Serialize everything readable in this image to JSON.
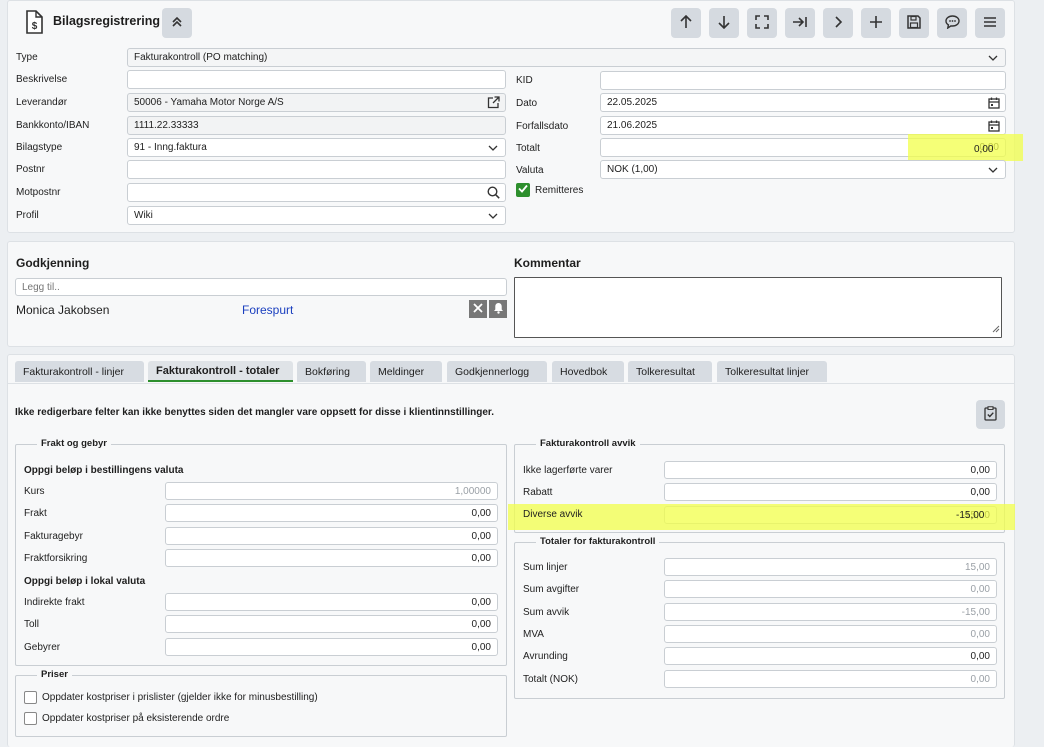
{
  "header": {
    "title": "Bilagsregistrering",
    "toolbar_icons": [
      "arrow-up-icon",
      "arrow-down-icon",
      "fullscreen-icon",
      "goto-last-icon",
      "next-icon",
      "add-icon",
      "save-icon",
      "chat-icon",
      "menu-icon"
    ]
  },
  "form": {
    "type_label": "Type",
    "type_value": "Fakturakontroll (PO matching)",
    "beskrivelse_label": "Beskrivelse",
    "beskrivelse_value": "",
    "leverandor_label": "Leverandør",
    "leverandor_value": "50006 - Yamaha Motor Norge A/S",
    "bankkonto_label": "Bankkonto/IBAN",
    "bankkonto_value": "1111.22.33333",
    "bilagstype_label": "Bilagstype",
    "bilagstype_value": "91 - Inng.faktura",
    "postnr_label": "Postnr",
    "postnr_value": "",
    "motpostnr_label": "Motpostnr",
    "motpostnr_value": "",
    "profil_label": "Profil",
    "profil_value": "Wiki",
    "kid_label": "KID",
    "kid_value": "",
    "dato_label": "Dato",
    "dato_value": "22.05.2025",
    "forfallsdato_label": "Forfallsdato",
    "forfallsdato_value": "21.06.2025",
    "totalt_label": "Totalt",
    "totalt_value": "0,00",
    "valuta_label": "Valuta",
    "valuta_value": "NOK (1,00)",
    "remitteres_label": "Remitteres",
    "remitteres_checked": true
  },
  "approval": {
    "title": "Godkjenning",
    "add_placeholder": "Legg til..",
    "approver_name": "Monica Jakobsen",
    "approver_status": "Forespurt",
    "comment_title": "Kommentar",
    "comment_value": ""
  },
  "tabs": [
    {
      "label": "Fakturakontroll - linjer"
    },
    {
      "label": "Fakturakontroll - totaler",
      "active": true
    },
    {
      "label": "Bokføring"
    },
    {
      "label": "Meldinger"
    },
    {
      "label": "Godkjennerlogg"
    },
    {
      "label": "Hovedbok"
    },
    {
      "label": "Tolkeresultat"
    },
    {
      "label": "Tolkeresultat linjer"
    }
  ],
  "totals": {
    "info_text": "Ikke redigerbare felter kan ikke benyttes siden det mangler vare oppsett for disse i klientinnstillinger.",
    "frakt": {
      "legend": "Frakt og gebyr",
      "section1": "Oppgi beløp i bestillingens valuta",
      "kurs_label": "Kurs",
      "kurs_value": "1,00000",
      "frakt_label": "Frakt",
      "frakt_value": "0,00",
      "fakturagebyr_label": "Fakturagebyr",
      "fakturagebyr_value": "0,00",
      "fraktforsikring_label": "Fraktforsikring",
      "fraktforsikring_value": "0,00",
      "section2": "Oppgi beløp i lokal valuta",
      "indirekte_label": "Indirekte frakt",
      "indirekte_value": "0,00",
      "toll_label": "Toll",
      "toll_value": "0,00",
      "gebyrer_label": "Gebyrer",
      "gebyrer_value": "0,00"
    },
    "priser": {
      "legend": "Priser",
      "opt1": "Oppdater kostpriser i prislister (gjelder ikke for minusbestilling)",
      "opt2": "Oppdater kostpriser på eksisterende ordre"
    },
    "avvik": {
      "legend": "Fakturakontroll avvik",
      "ikke_lager_label": "Ikke lagerførte varer",
      "ikke_lager_value": "0,00",
      "rabatt_label": "Rabatt",
      "rabatt_value": "0,00",
      "diverse_label": "Diverse avvik",
      "diverse_value": "-15,00"
    },
    "sum": {
      "legend": "Totaler for fakturakontroll",
      "sum_linjer_label": "Sum linjer",
      "sum_linjer_value": "15,00",
      "sum_avgifter_label": "Sum avgifter",
      "sum_avgifter_value": "0,00",
      "sum_avvik_label": "Sum avvik",
      "sum_avvik_value": "-15,00",
      "mva_label": "MVA",
      "mva_value": "0,00",
      "avrunding_label": "Avrunding",
      "avrunding_value": "0,00",
      "totalt_label": "Totalt (NOK)",
      "totalt_value": "0,00"
    }
  },
  "colors": {
    "highlight": "#f2ff4a",
    "accent_green": "#2d8f2d",
    "link_blue": "#1a3fbf"
  }
}
